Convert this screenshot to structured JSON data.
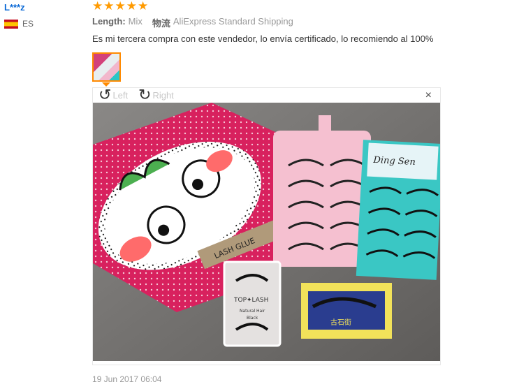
{
  "review": {
    "user": "L***z",
    "country": "ES",
    "stars": [
      "★",
      "★",
      "★",
      "★",
      "★"
    ],
    "length_label": "Length:",
    "length_value": "Mix",
    "shipping_label": "物流",
    "shipping_value": "AliExpress Standard Shipping",
    "text": "Es mi tercera compra con este vendedor, lo envía certificado, lo recomiendo al 100%",
    "date": "19 Jun 2017 06:04"
  },
  "viewer": {
    "rotate_left": "Left",
    "rotate_right": "Right",
    "close": "×"
  },
  "photo_text": {
    "top_lash": "TOP✦LASH",
    "natural_hair": "Natural Hair",
    "black": "Black",
    "ding_sen": "Ding Sen",
    "lash_glue": "LASH GLUE",
    "bottom_box": "古石街"
  },
  "colors": {
    "star": "#ff9a00",
    "user_link": "#0a69d6",
    "thumb_border": "#ff8a00"
  }
}
